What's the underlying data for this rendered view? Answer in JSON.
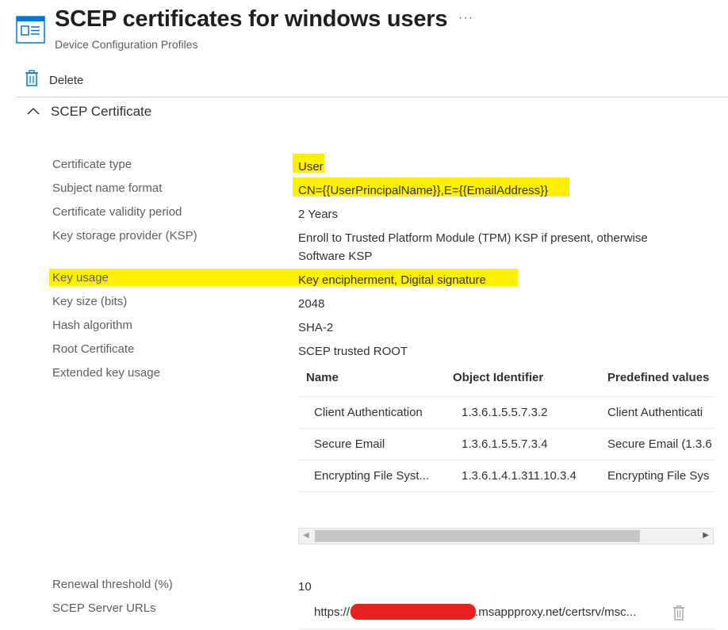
{
  "header": {
    "title": "SCEP certificates for windows users",
    "subtitle": "Device Configuration Profiles",
    "more_label": "···",
    "icon": "profile-icon"
  },
  "toolbar": {
    "delete_label": "Delete",
    "icon": "trash-icon"
  },
  "section": {
    "title": "SCEP Certificate",
    "icon": "chevron-up-icon"
  },
  "properties": [
    {
      "label": "Certificate type",
      "value": "User"
    },
    {
      "label": "Subject name format",
      "value": "CN={{UserPrincipalName}},E={{EmailAddress}}"
    },
    {
      "label": "Certificate validity period",
      "value": "2 Years"
    },
    {
      "label": "Key storage provider (KSP)",
      "value": "Enroll to Trusted Platform Module (TPM) KSP if present, otherwise",
      "value2": "Software KSP"
    },
    {
      "label": "Key usage",
      "value": "Key encipherment, Digital signature"
    },
    {
      "label": "Key size (bits)",
      "value": "2048"
    },
    {
      "label": "Hash algorithm",
      "value": "SHA-2"
    },
    {
      "label": "Root Certificate",
      "value": "SCEP trusted ROOT"
    },
    {
      "label": "Extended key usage"
    }
  ],
  "eku_table": {
    "columns": [
      "Name",
      "Object Identifier",
      "Predefined values"
    ],
    "rows": [
      [
        "Client Authentication",
        "1.3.6.1.5.5.7.3.2",
        "Client Authenticati"
      ],
      [
        "Secure Email",
        "1.3.6.1.5.5.7.3.4",
        "Secure Email (1.3.6"
      ],
      [
        "Encrypting File Syst...",
        "1.3.6.1.4.1.311.10.3.4",
        "Encrypting File Sys"
      ]
    ]
  },
  "renewal": {
    "label": "Renewal threshold (%)",
    "value": "10"
  },
  "scep_urls": {
    "label": "SCEP Server URLs",
    "prefix": "https://",
    "suffix": ".msappproxy.net/certsrv/msc..."
  },
  "colors": {
    "highlight": "#fff000",
    "redaction": "#e82020",
    "accent": "#0078d4"
  }
}
